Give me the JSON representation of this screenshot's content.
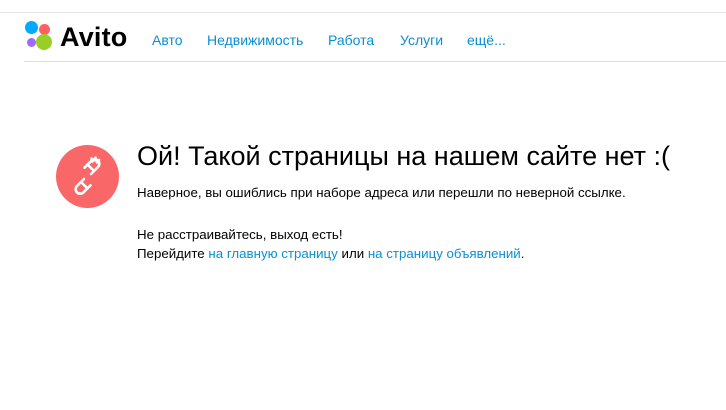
{
  "header": {
    "logo_text": "Avito",
    "logo_colors": [
      "#0af",
      "#97cf26",
      "#ff6163",
      "#a169f7"
    ],
    "nav": [
      {
        "label": "Авто"
      },
      {
        "label": "Недвижимость"
      },
      {
        "label": "Работа"
      },
      {
        "label": "Услуги"
      },
      {
        "label": "ещё..."
      }
    ]
  },
  "error": {
    "icon": "broken-link-icon",
    "icon_color": "#f96768",
    "title": "Ой! Такой страницы на нашем сайте нет :(",
    "message": "Наверное, вы ошиблись при наборе адреса или перешли по неверной ссылке.",
    "reassure": "Не расстраивайтесь, выход есть!",
    "goto_prefix": "Перейдите ",
    "link_home": "на главную страницу",
    "goto_middle": " или ",
    "link_ads": "на страницу объявлений",
    "goto_suffix": "."
  },
  "colors": {
    "link": "#0a8fd1"
  }
}
